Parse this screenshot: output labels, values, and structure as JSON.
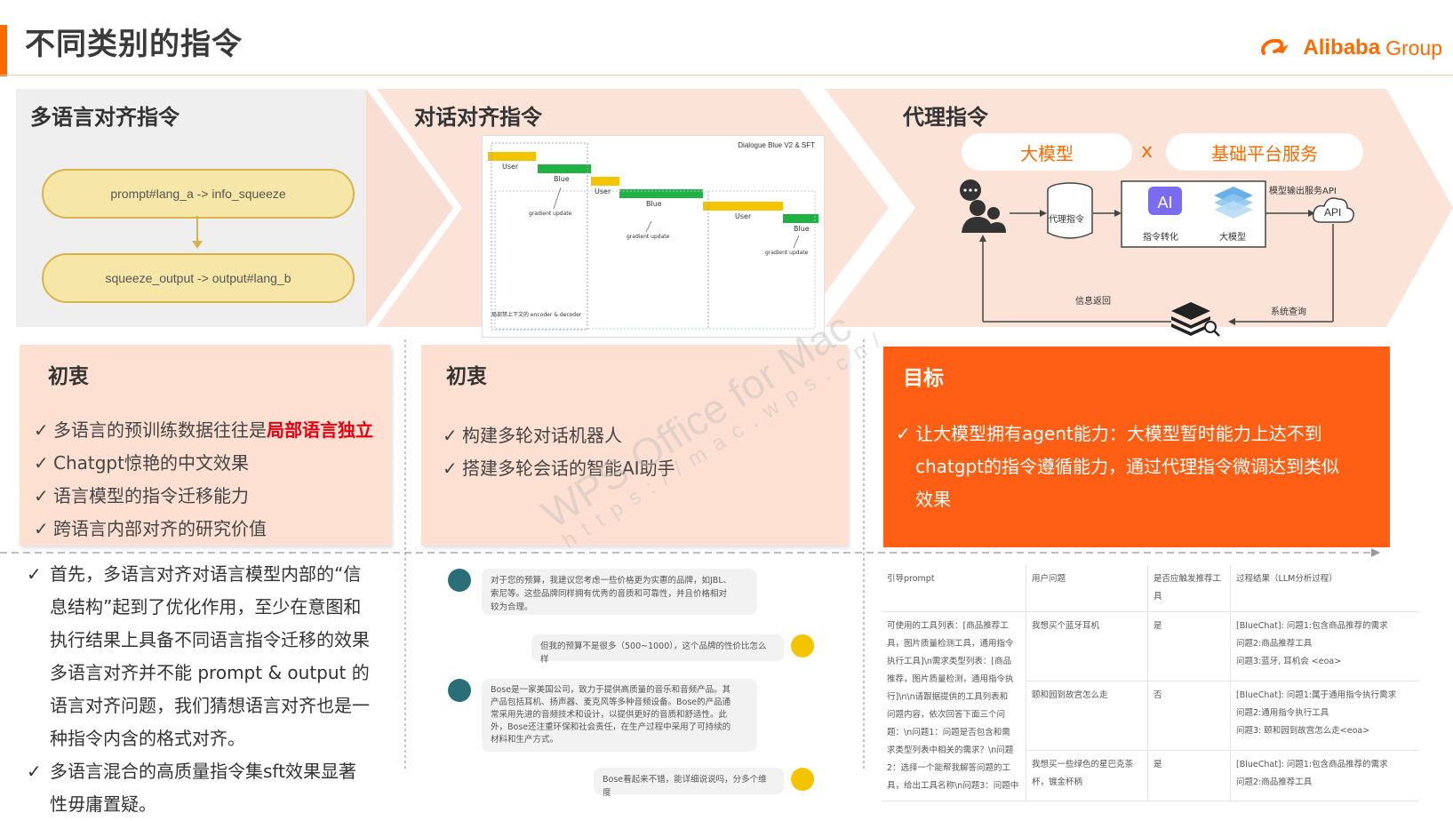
{
  "page": {
    "title": "不同类别的指令"
  },
  "logo": {
    "brand": "Alibaba",
    "group": "Group"
  },
  "colors": {
    "accent": "#ff6a00",
    "highlight": "#e60012",
    "pill": "#f6e7a8",
    "panel_peach": "#fde0d2"
  },
  "sections": {
    "multilingual": {
      "title": "多语言对齐指令",
      "pill_top": "prompt#lang_a -> info_squeeze",
      "pill_bottom": "squeeze_output -> output#lang_b"
    },
    "dialogue": {
      "title": "对话对齐指令",
      "figure": {
        "caption": "Dialogue Blue V2 & SFT",
        "labels": [
          "User",
          "Blue",
          "User",
          "Blue",
          "User",
          "Blue"
        ],
        "notes": [
          "gradient update",
          "gradient update",
          "gradient update"
        ],
        "footer": "局部禁上下文的 encoder & decoder"
      }
    },
    "agent": {
      "title": "代理指令",
      "pill_left": "大模型",
      "times": "x",
      "pill_right": "基础平台服务",
      "diagram": {
        "db_label": "代理指令",
        "ai_label": "指令转化",
        "model_label": "大模型",
        "api_top": "模型输出服务API",
        "api": "API",
        "info_return": "信息返回",
        "system_query": "系统查询"
      }
    }
  },
  "boxes": {
    "multilingual": {
      "heading": "初衷",
      "items": [
        {
          "pre": "多语言的预训练数据往往是",
          "hl": "局部语言独立"
        },
        {
          "pre": "Chatgpt惊艳的中文效果",
          "hl": ""
        },
        {
          "pre": "语言模型的指令迁移能力",
          "hl": ""
        },
        {
          "pre": "跨语言内部对齐的研究价值",
          "hl": ""
        }
      ]
    },
    "dialogue": {
      "heading": "初衷",
      "items": [
        "构建多轮对话机器人",
        "搭建多轮会话的智能AI助手"
      ]
    },
    "agent": {
      "heading": "目标",
      "lines": [
        "让大模型拥有agent能力：大模型暂时能力上达不到",
        "chatgpt的指令遵循能力，通过代理指令微调达到类似",
        "效果"
      ]
    }
  },
  "notes": {
    "item1_lines": [
      "首先，多语言对齐对语言模型内部的“信",
      "息结构”起到了优化作用，至少在意图和",
      "执行结果上具备不同语言指令迁移的效果",
      "多语言对齐并不能 prompt & output 的",
      "语言对齐问题，我们猜想语言对齐也是一",
      "种指令内含的格式对齐。"
    ],
    "item2_lines": [
      "多语言混合的高质量指令集sft效果显著",
      "性毋庸置疑。"
    ]
  },
  "chat": {
    "m1": [
      "对于您的预算，我建议您考虑一些价格更为实惠的品牌，如JBL、",
      "索尼等。这些品牌同样拥有优秀的音质和可靠性，并且价格相对",
      "较为合理。"
    ],
    "m2": "但我的预算不是很多（500~1000），这个品牌的性价比怎么样",
    "m3": [
      "Bose是一家美国公司，致力于提供高质量的音乐和音频产品。其",
      "产品包括耳机、扬声器、麦克风等多种音频设备。Bose的产品通",
      "常采用先进的音频技术和设计，以提供更好的音质和舒适性。此",
      "外，Bose还注重环保和社会责任，在生产过程中采用了可持续的",
      "材料和生产方式。"
    ],
    "m4": "Bose看起来不错，能详细说说吗，分多个维度"
  },
  "table": {
    "headers": [
      "引导prompt",
      "用户问题",
      "是否应触发推荐工具",
      "过程结果（LLM分析过程）"
    ],
    "prompt_lines": [
      "可使用的工具列表：[商品推荐工",
      "具，图片质量检测工具，通用指令",
      "执行工具]\\n需求类型列表：[商品",
      "推荐，图片质量检测，通用指令执",
      "行]\\n\\n请跟据提供的工具列表和",
      "问题内容，依次回答下面三个问",
      "题：\\n问题1：问题是否包含和需",
      "求类型列表中相关的需求？\\n问题",
      "2：选择一个能帮我解答问题的工",
      "具，给出工具名称\\n问题3：问题中"
    ],
    "rows": [
      {
        "q": "我想买个蓝牙耳机",
        "trig": "是",
        "res": [
          "[BlueChat]: 问题1:包含商品推荐的需求",
          "问题2:商品推荐工具",
          "问题3:蓝牙, 耳机会 <eoa>"
        ]
      },
      {
        "q": "颐和园到故宫怎么走",
        "trig": "否",
        "res": [
          "[BlueChat]: 问题1:属于通用指令执行需求",
          "问题2:通用指令执行工具",
          "问题3: 颐和园到故宫怎么走<eoa>"
        ]
      },
      {
        "q": "我想买一些绿色的星巴克茶杯，镀金杯柄",
        "trig": "是",
        "res": [
          "[BlueChat]: 问题1:包含商品推荐的需求",
          "问题2:商品推荐工具"
        ]
      }
    ]
  },
  "watermark": {
    "line1": "WPS Office for Mac",
    "line2": "https://mac.wps.cn/"
  }
}
